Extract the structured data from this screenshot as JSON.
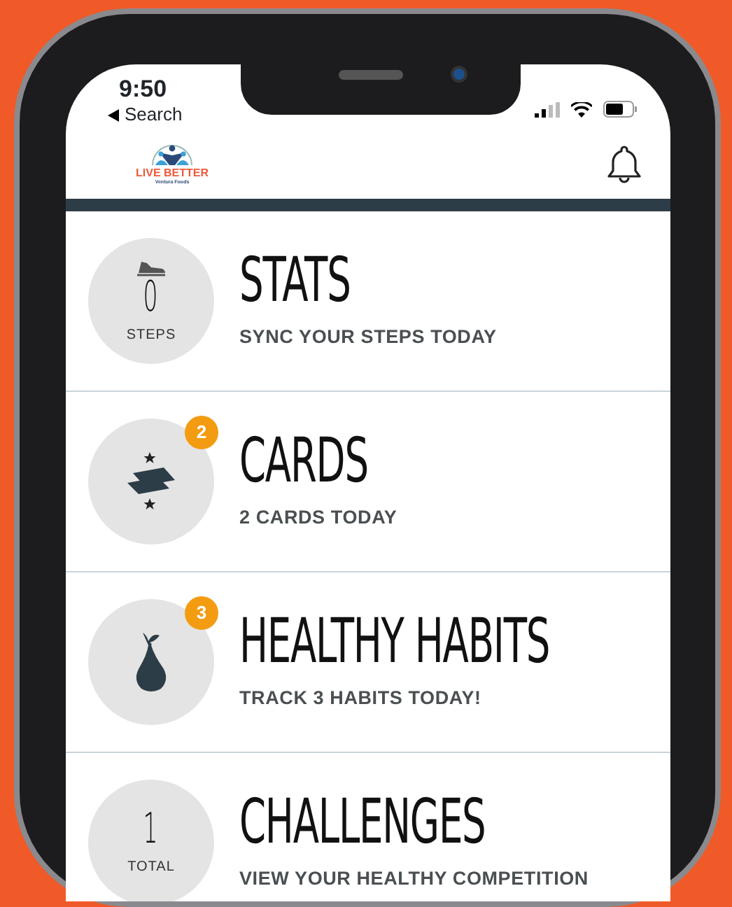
{
  "status_bar": {
    "time": "9:50",
    "back_label": "Search"
  },
  "header": {
    "logo_text": "LIVE BETTER",
    "logo_tagline": "Ventura Foods"
  },
  "tiles": [
    {
      "kind": "count",
      "value": "0",
      "unit": "STEPS",
      "title": "STATS",
      "subtitle": "SYNC YOUR STEPS TODAY"
    },
    {
      "kind": "icon",
      "badge": "2",
      "title": "CARDS",
      "subtitle": "2 CARDS TODAY"
    },
    {
      "kind": "icon",
      "badge": "3",
      "title": "HEALTHY HABITS",
      "subtitle": "TRACK 3 HABITS TODAY!"
    },
    {
      "kind": "count",
      "value": "1",
      "unit": "TOTAL",
      "title": "CHALLENGES",
      "subtitle": "VIEW YOUR HEALTHY COMPETITION"
    }
  ]
}
